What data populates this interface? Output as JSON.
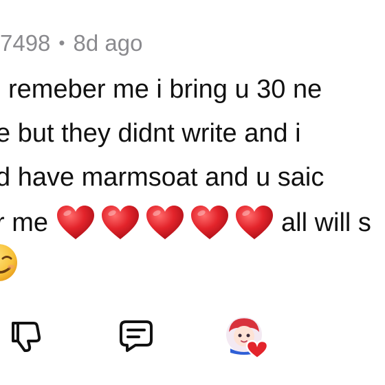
{
  "comment": {
    "username_fragment": "7498",
    "separator": "•",
    "timestamp": "8d ago",
    "lines": [
      "remeber me i bring u 30 ne",
      "e but they didnt write and i",
      "d have marmsoat and u saic",
      "r me"
    ],
    "line4_tail": "all will s",
    "heart_count": 5,
    "heart_emoji": "red-heart",
    "trailing_emoji": "smiling-face"
  },
  "actions": {
    "dislike_icon": "thumbs-down-icon",
    "reply_icon": "comment-icon",
    "creator_heart": "creator-heart-avatar"
  },
  "colors": {
    "meta_text": "#8a8a8e",
    "body_text": "#111111",
    "heart_red": "#e3242b",
    "emoji_yellow": "#f7c23a"
  }
}
